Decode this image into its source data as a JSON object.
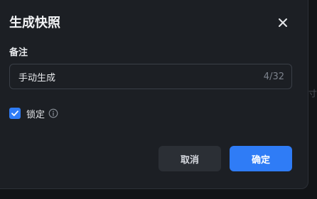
{
  "dialog": {
    "title": "生成快照",
    "close_icon": "close-icon"
  },
  "note": {
    "label": "备注",
    "value": "手动生成",
    "counter": "4/32"
  },
  "lock": {
    "label": "锁定",
    "checked": true,
    "info_icon": "info-icon"
  },
  "actions": {
    "cancel_label": "取消",
    "confirm_label": "确定"
  },
  "background": {
    "hint_text": "寸"
  },
  "colors": {
    "accent": "#2f7cf6",
    "dialog_bg": "#1c1f24",
    "text_primary": "#f2f3f5",
    "text_muted": "#7c828c"
  }
}
